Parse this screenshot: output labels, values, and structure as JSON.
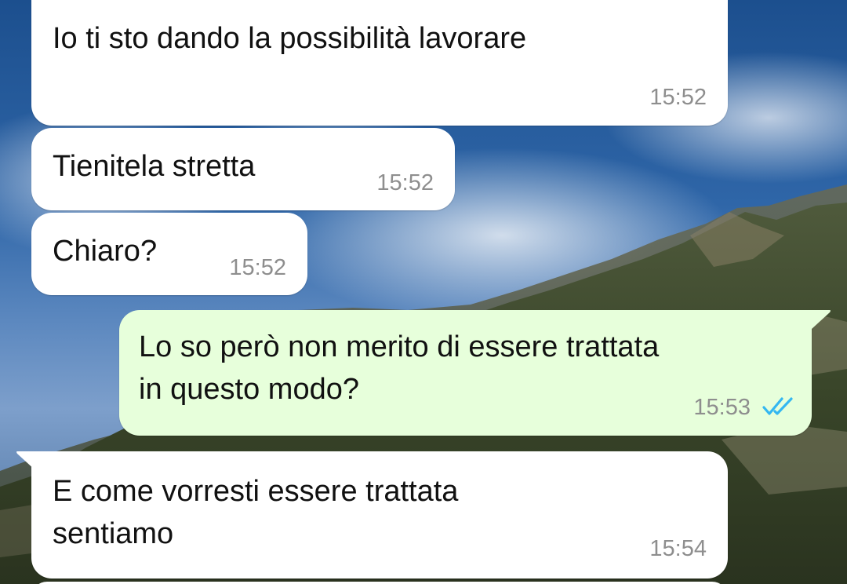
{
  "chat": {
    "messages": [
      {
        "direction": "incoming",
        "text": "Io ti sto dando la possibilità lavorare",
        "time": "15:52"
      },
      {
        "direction": "incoming",
        "text": "Tienitela stretta",
        "time": "15:52"
      },
      {
        "direction": "incoming",
        "text": "Chiaro?",
        "time": "15:52"
      },
      {
        "direction": "outgoing",
        "text_lines": [
          "Lo so però non merito di essere trattata",
          "in questo modo?"
        ],
        "time": "15:53",
        "status": "read",
        "status_icon": "double-check-icon"
      },
      {
        "direction": "incoming",
        "text_lines": [
          "E come vorresti essere trattata",
          "sentiamo"
        ],
        "time": "15:54"
      }
    ]
  },
  "colors": {
    "incoming_bubble": "#ffffff",
    "outgoing_bubble": "#e7ffdb",
    "timestamp": "#8e8e8e",
    "read_ticks": "#34b7f1"
  },
  "wallpaper": {
    "subject": "mountain-and-sky-photo"
  }
}
